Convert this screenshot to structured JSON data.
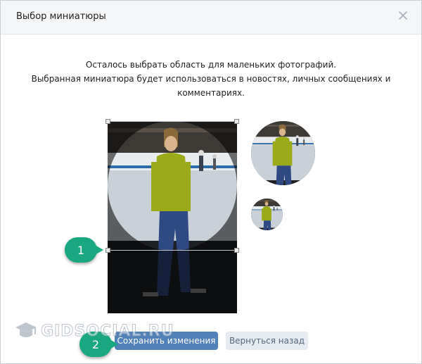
{
  "dialog": {
    "title": "Выбор миниатюры",
    "description_line1": "Осталось выбрать область для маленьких фотографий.",
    "description_line2": "Выбранная миниатюра будет использоваться в новостях, личных сообщениях и",
    "description_line3": "комментариях."
  },
  "icons": {
    "close": "close-icon",
    "watermark_logo": "graduation-cap-icon"
  },
  "badges": {
    "step1": "1",
    "step2": "2"
  },
  "buttons": {
    "save": "Сохранить изменения",
    "back": "Вернуться назад"
  },
  "watermark": {
    "text": "GIDSOCIAL.RU"
  },
  "colors": {
    "accent": "#5181b8",
    "badge": "#19a882",
    "secondary_button": "#e5ebf1"
  }
}
